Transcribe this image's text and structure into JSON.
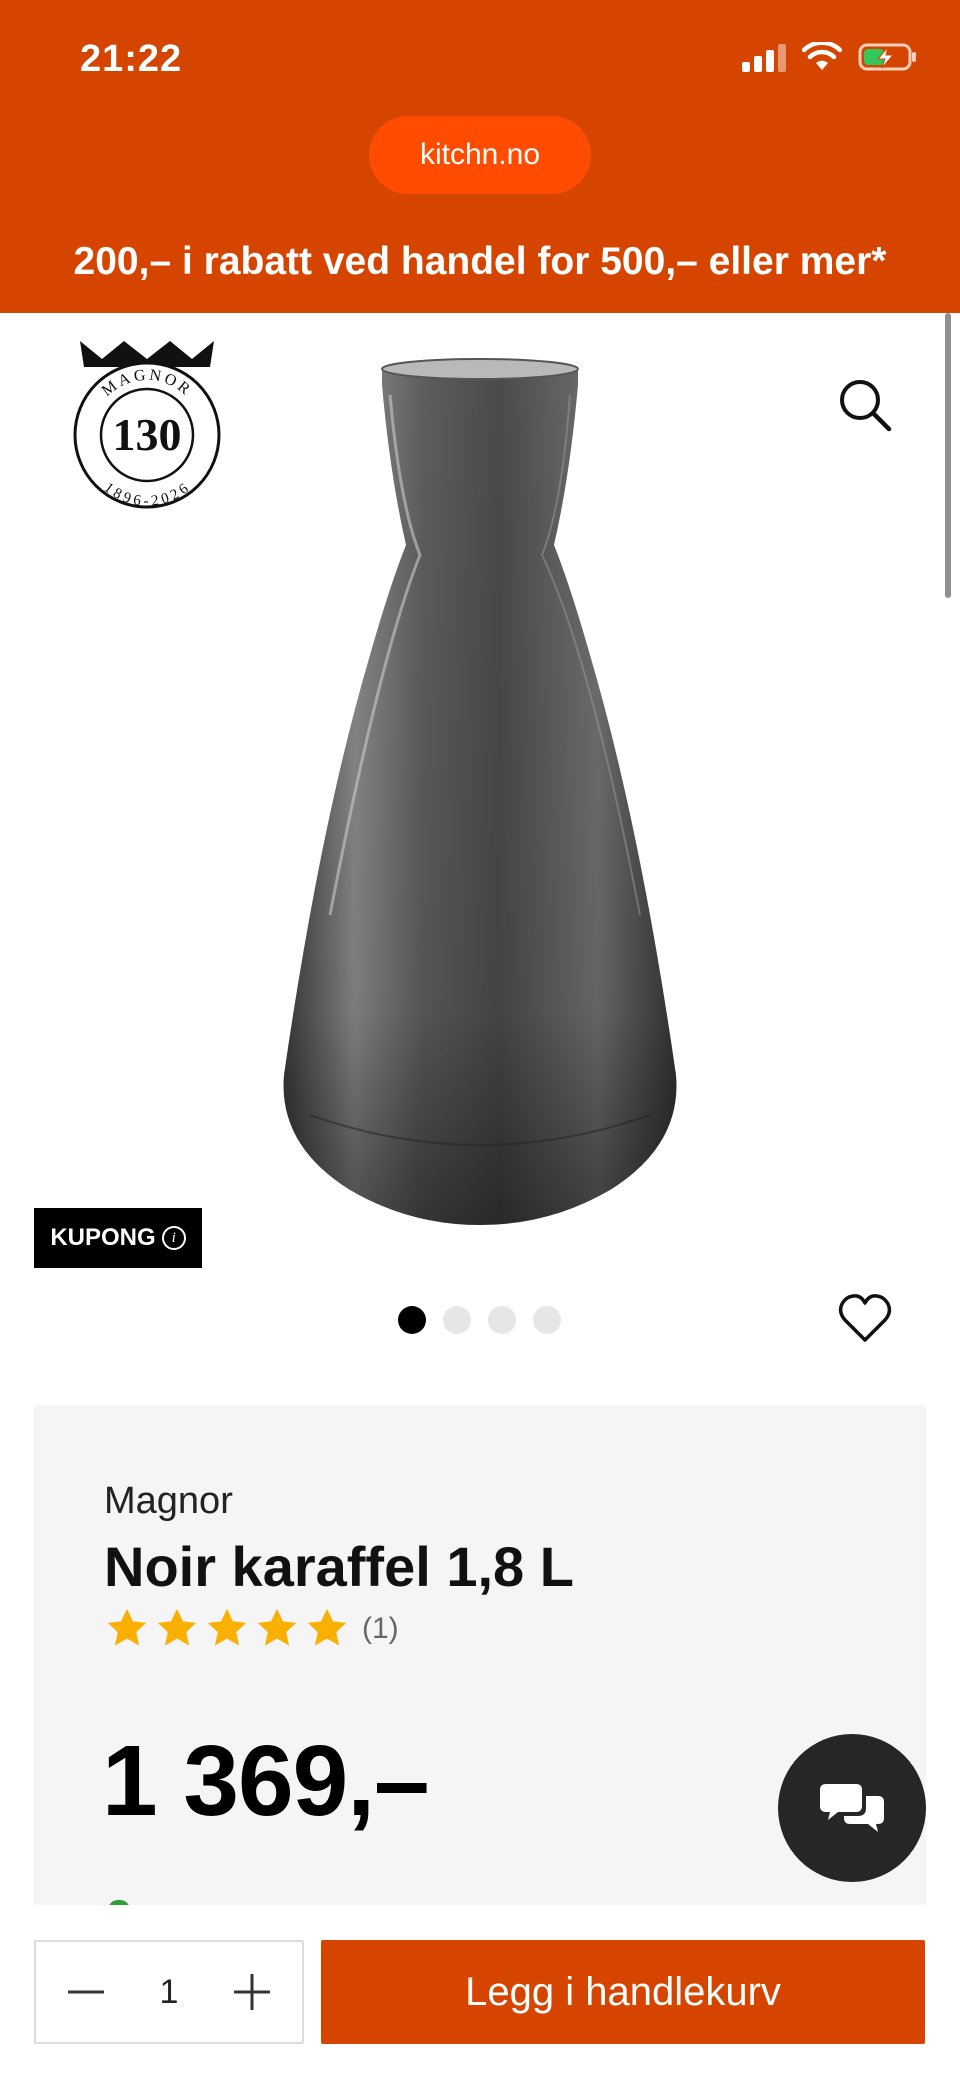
{
  "status_bar": {
    "time": "21:22",
    "icons": [
      "signal-icon",
      "wifi-icon",
      "battery-charging-icon"
    ]
  },
  "browser": {
    "url": "kitchn.no"
  },
  "promo_banner": {
    "text": "200,– i rabatt ved handel for 500,– eller mer*"
  },
  "product_image": {
    "logo": {
      "brand": "MAGNOR",
      "number": "130",
      "years": "1896-2026"
    },
    "badge_label": "KUPONG",
    "carousel": {
      "total": 4,
      "active": 1
    }
  },
  "product": {
    "brand": "Magnor",
    "name": "Noir karaffel 1,8 L",
    "rating": 5,
    "review_count": "(1)",
    "price": "1 369,–"
  },
  "cart_bar": {
    "quantity": "1",
    "add_button_label": "Legg i handlekurv"
  },
  "colors": {
    "brand_orange": "#d54500",
    "url_pill": "#ff4c00",
    "star": "#f9b000",
    "card_bg": "#f5f5f5"
  }
}
